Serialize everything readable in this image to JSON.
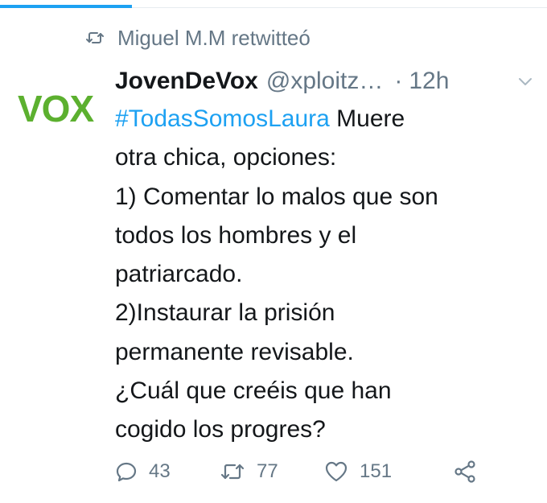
{
  "retweet_context": {
    "text": "Miguel M.M retwitteó"
  },
  "author": {
    "display_name": "JovenDeVox",
    "handle": "@xploitz…",
    "time_separator": "·",
    "time": "12h",
    "avatar_text": "VOX"
  },
  "tweet": {
    "hashtag": "#TodasSomosLaura",
    "line1_rest": " Muere",
    "line2": "otra chica, opciones:",
    "line3": "1) Comentar lo malos que son",
    "line4": "todos los hombres y el",
    "line5": "patriarcado.",
    "line6": "2)Instaurar la prisión",
    "line7": "permanente revisable.",
    "line8": "¿Cuál que creéis que han",
    "line9": "cogido los progres?"
  },
  "actions": {
    "replies": "43",
    "retweets": "77",
    "likes": "151"
  },
  "icons": {
    "retweet_context": "retweet-icon",
    "caret": "chevron-down-icon",
    "reply": "reply-icon",
    "retweet": "retweet-icon",
    "like": "heart-icon",
    "share": "share-icon"
  },
  "colors": {
    "accent": "#1da1f2",
    "muted": "#657786",
    "text": "#14171a",
    "vox_green": "#5cb02f"
  }
}
